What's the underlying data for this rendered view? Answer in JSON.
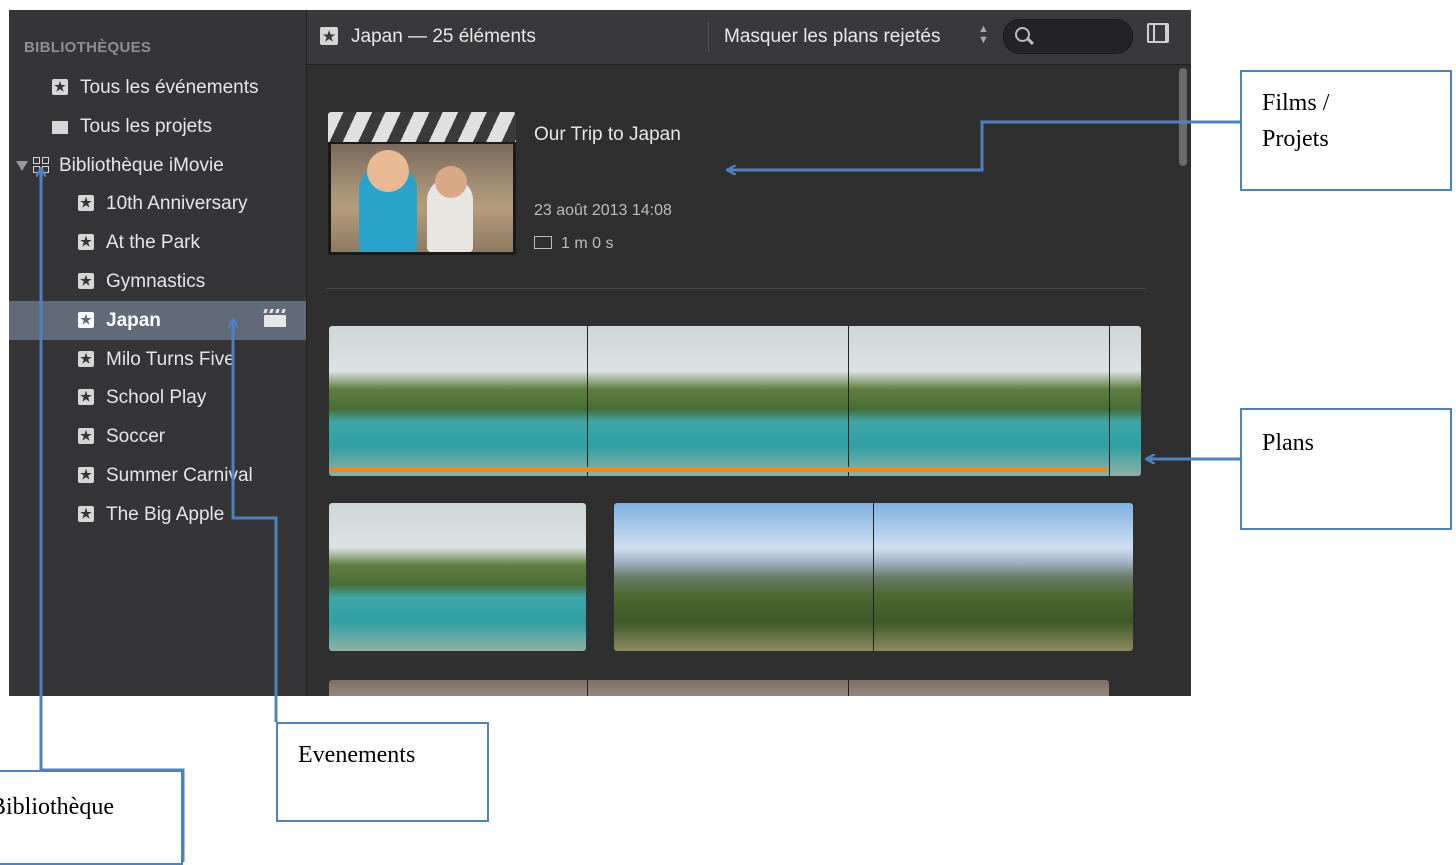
{
  "sidebar": {
    "heading": "BIBLIOTHÈQUES",
    "items": [
      {
        "label": "Tous les événements",
        "icon": "star-icon"
      },
      {
        "label": "Tous les projets",
        "icon": "clapper-icon"
      },
      {
        "label": "Bibliothèque iMovie",
        "icon": "library-grid-icon",
        "expanded": true
      },
      {
        "label": "10th Anniversary",
        "icon": "star-icon"
      },
      {
        "label": "At the Park",
        "icon": "star-icon"
      },
      {
        "label": "Gymnastics",
        "icon": "star-icon"
      },
      {
        "label": "Japan",
        "icon": "star-icon",
        "selected": true
      },
      {
        "label": "Milo Turns Five",
        "icon": "star-icon"
      },
      {
        "label": "School Play",
        "icon": "star-icon"
      },
      {
        "label": "Soccer",
        "icon": "star-icon"
      },
      {
        "label": "Summer Carnival",
        "icon": "star-icon"
      },
      {
        "label": "The Big Apple",
        "icon": "star-icon"
      }
    ]
  },
  "toolbar": {
    "title": "Japan — 25 éléments",
    "filter": "Masquer les plans rejetés",
    "search_placeholder": ""
  },
  "project": {
    "title": "Our Trip to Japan",
    "date": "23 août 2013 14:08",
    "duration": "1 m 0 s"
  },
  "annotations": {
    "films": [
      "Films /",
      "Projets"
    ],
    "plans": "Plans",
    "evenements": "Evenements",
    "bibliotheque": "Bibliothèque"
  },
  "colors": {
    "selection": "#616a78",
    "accent_orange": "#ef8a1a",
    "annotation_blue": "#4f81bd"
  }
}
